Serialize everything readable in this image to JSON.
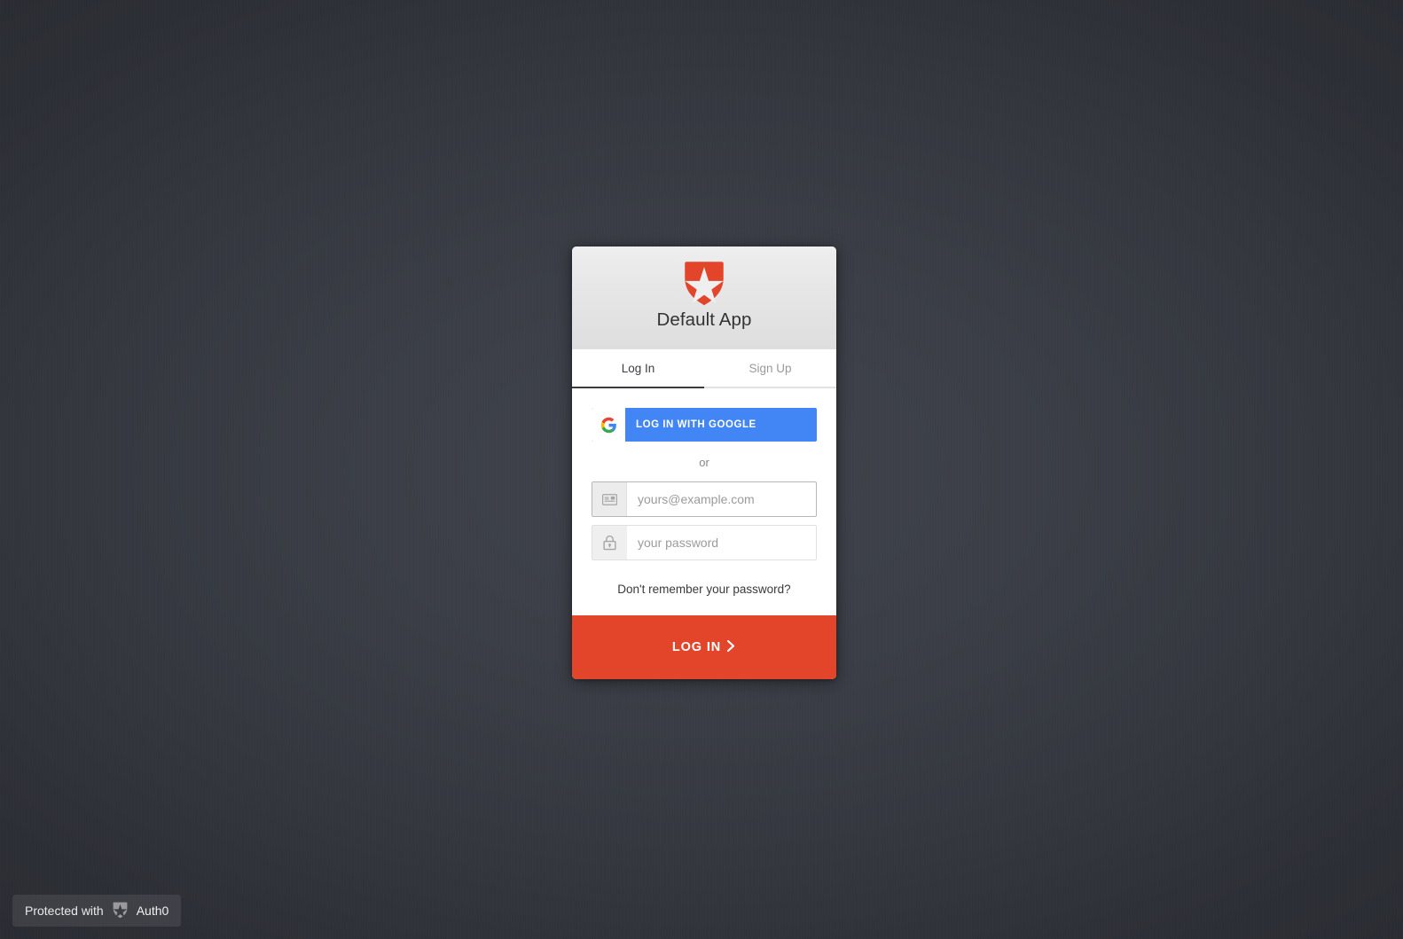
{
  "page": {
    "background_color": "#2b2d33",
    "background_center_color": "#40434b"
  },
  "widget": {
    "header": {
      "logo_icon": "auth0-shield-star-icon",
      "logo_color": "#e2452a",
      "app_title": "Default App"
    },
    "tabs": [
      {
        "id": "login",
        "label": "Log In",
        "active": true
      },
      {
        "id": "signup",
        "label": "Sign Up",
        "active": false
      }
    ],
    "social": {
      "google_button_label": "LOG IN WITH GOOGLE",
      "google_icon": "google-g-icon",
      "google_button_color": "#4285f4"
    },
    "separator_label": "or",
    "fields": [
      {
        "id": "email",
        "icon": "email-card-icon",
        "placeholder": "yours@example.com",
        "value": "",
        "focused": true
      },
      {
        "id": "password",
        "icon": "lock-icon",
        "placeholder": "your password",
        "value": "",
        "focused": false
      }
    ],
    "forgot_password_label": "Don't remember your password?",
    "submit": {
      "label": "LOG IN",
      "chevron_icon": "chevron-right-icon",
      "color": "#e2452a"
    }
  },
  "badge": {
    "prefix_label": "Protected with",
    "shield_icon": "auth0-shield-star-icon",
    "brand_label": "Auth0"
  }
}
